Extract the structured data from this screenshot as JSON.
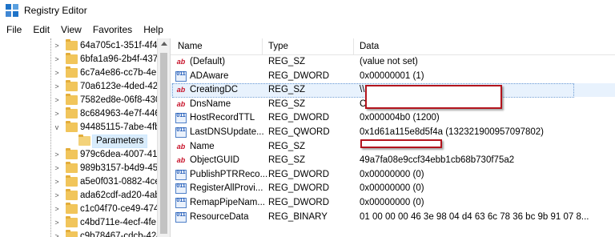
{
  "window": {
    "title": "Registry Editor"
  },
  "menu": [
    "File",
    "Edit",
    "View",
    "Favorites",
    "Help"
  ],
  "tree": {
    "items": [
      {
        "label": "64a705c1-351f-4f47",
        "expander": ">"
      },
      {
        "label": "6bfa1a96-2b4f-437",
        "expander": ">"
      },
      {
        "label": "6c7a4e86-cc7b-4eb",
        "expander": ">"
      },
      {
        "label": "70a6123e-4ded-42c",
        "expander": ">"
      },
      {
        "label": "7582ed8e-06f8-430",
        "expander": ">"
      },
      {
        "label": "8c684963-4e7f-446",
        "expander": ">"
      },
      {
        "label": "94485115-7abe-4fb",
        "expander": "v"
      },
      {
        "label": "Parameters",
        "expander": ""
      },
      {
        "label": "979c6dea-4007-41a",
        "expander": ">"
      },
      {
        "label": "989b3157-b4d9-45",
        "expander": ">"
      },
      {
        "label": "a5e0f031-0882-4ce",
        "expander": ">"
      },
      {
        "label": "ada62cdf-ad20-4ab",
        "expander": ">"
      },
      {
        "label": "c1c04f70-ce49-474",
        "expander": ">"
      },
      {
        "label": "c4bd711e-4ecf-4fe",
        "expander": ">"
      },
      {
        "label": "c9b78467-cdcb-424",
        "expander": ">"
      }
    ]
  },
  "columns": {
    "name": "Name",
    "type": "Type",
    "data": "Data"
  },
  "values": [
    {
      "icon": "string-value-icon",
      "glyph": "ab",
      "name": "(Default)",
      "type": "REG_SZ",
      "data": "(value not set)"
    },
    {
      "icon": "binary-value-icon",
      "glyph": "011",
      "name": "ADAware",
      "type": "REG_DWORD",
      "data": "0x00000001 (1)"
    },
    {
      "icon": "string-value-icon",
      "glyph": "ab",
      "name": "CreatingDC",
      "type": "REG_SZ",
      "data": "\\\\"
    },
    {
      "icon": "string-value-icon",
      "glyph": "ab",
      "name": "DnsName",
      "type": "REG_SZ",
      "data": "C"
    },
    {
      "icon": "binary-value-icon",
      "glyph": "011",
      "name": "HostRecordTTL",
      "type": "REG_DWORD",
      "data": "0x000004b0 (1200)"
    },
    {
      "icon": "binary-value-icon",
      "glyph": "011",
      "name": "LastDNSUpdate...",
      "type": "REG_QWORD",
      "data": "0x1d61a115e8d5f4a (132321900957097802)"
    },
    {
      "icon": "string-value-icon",
      "glyph": "ab",
      "name": "Name",
      "type": "REG_SZ",
      "data": ""
    },
    {
      "icon": "string-value-icon",
      "glyph": "ab",
      "name": "ObjectGUID",
      "type": "REG_SZ",
      "data": "49a7fa08e9ccf34ebb1cb68b730f75a2"
    },
    {
      "icon": "binary-value-icon",
      "glyph": "011",
      "name": "PublishPTRReco...",
      "type": "REG_DWORD",
      "data": "0x00000000 (0)"
    },
    {
      "icon": "binary-value-icon",
      "glyph": "011",
      "name": "RegisterAllProvi...",
      "type": "REG_DWORD",
      "data": "0x00000000 (0)"
    },
    {
      "icon": "binary-value-icon",
      "glyph": "011",
      "name": "RemapPipeNam...",
      "type": "REG_DWORD",
      "data": "0x00000000 (0)"
    },
    {
      "icon": "binary-value-icon",
      "glyph": "011",
      "name": "ResourceData",
      "type": "REG_BINARY",
      "data": "01 00 00 00 46 3e 98 04 d4 63 6c 78 36 bc 9b 91 07 8..."
    }
  ],
  "colors": {
    "annotation": "#b3141d",
    "folder": "#f1c55b",
    "selection": "#e8f2fd"
  }
}
